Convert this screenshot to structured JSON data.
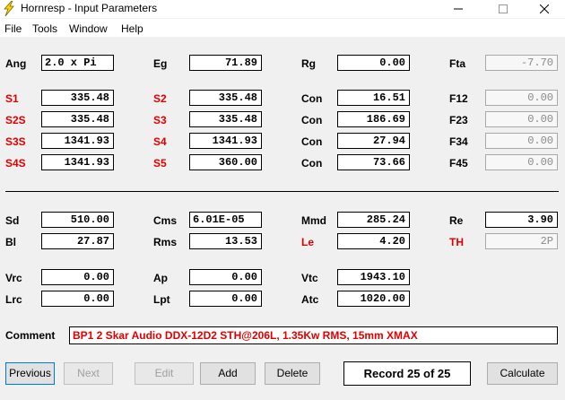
{
  "window": {
    "title": "Hornresp - Input Parameters",
    "min_symbol": "—",
    "max_symbol": "☐",
    "close_symbol": "✕"
  },
  "menu": [
    "File",
    "Tools",
    "Window",
    "Help"
  ],
  "fields": {
    "ang": {
      "label": "Ang",
      "value": "2.0 x Pi"
    },
    "eg": {
      "label": "Eg",
      "value": "71.89"
    },
    "rg": {
      "label": "Rg",
      "value": "0.00"
    },
    "fta": {
      "label": "Fta",
      "value": "-7.70"
    },
    "s1": {
      "label": "S1",
      "value": "335.48"
    },
    "s2": {
      "label": "S2",
      "value": "335.48"
    },
    "con1": {
      "label": "Con",
      "value": "16.51"
    },
    "f12": {
      "label": "F12",
      "value": "0.00"
    },
    "s2s": {
      "label": "S2S",
      "value": "335.48"
    },
    "s3": {
      "label": "S3",
      "value": "335.48"
    },
    "con2": {
      "label": "Con",
      "value": "186.69"
    },
    "f23": {
      "label": "F23",
      "value": "0.00"
    },
    "s3s": {
      "label": "S3S",
      "value": "1341.93"
    },
    "s4": {
      "label": "S4",
      "value": "1341.93"
    },
    "con3": {
      "label": "Con",
      "value": "27.94"
    },
    "f34": {
      "label": "F34",
      "value": "0.00"
    },
    "s4s": {
      "label": "S4S",
      "value": "1341.93"
    },
    "s5": {
      "label": "S5",
      "value": "360.00"
    },
    "con4": {
      "label": "Con",
      "value": "73.66"
    },
    "f45": {
      "label": "F45",
      "value": "0.00"
    },
    "sd": {
      "label": "Sd",
      "value": "510.00"
    },
    "cms": {
      "label": "Cms",
      "value": "6.01E-05"
    },
    "mmd": {
      "label": "Mmd",
      "value": "285.24"
    },
    "re": {
      "label": "Re",
      "value": "3.90"
    },
    "bl": {
      "label": "Bl",
      "value": "27.87"
    },
    "rms": {
      "label": "Rms",
      "value": "13.53"
    },
    "le": {
      "label": "Le",
      "value": "4.20"
    },
    "th": {
      "label": "TH",
      "value": "2P"
    },
    "vrc": {
      "label": "Vrc",
      "value": "0.00"
    },
    "ap": {
      "label": "Ap",
      "value": "0.00"
    },
    "vtc": {
      "label": "Vtc",
      "value": "1943.10"
    },
    "lrc": {
      "label": "Lrc",
      "value": "0.00"
    },
    "lpt": {
      "label": "Lpt",
      "value": "0.00"
    },
    "atc": {
      "label": "Atc",
      "value": "1020.00"
    }
  },
  "comment": {
    "label": "Comment",
    "value": "BP1 2 Skar Audio DDX-12D2 STH@206L, 1.35Kw RMS, 15mm XMAX"
  },
  "buttons": {
    "previous": "Previous",
    "next": "Next",
    "edit": "Edit",
    "add": "Add",
    "delete": "Delete",
    "calculate": "Calculate"
  },
  "record": "Record 25 of 25",
  "colors": {
    "red_label": "#e00000",
    "icon_yellow": "#ffd800"
  }
}
